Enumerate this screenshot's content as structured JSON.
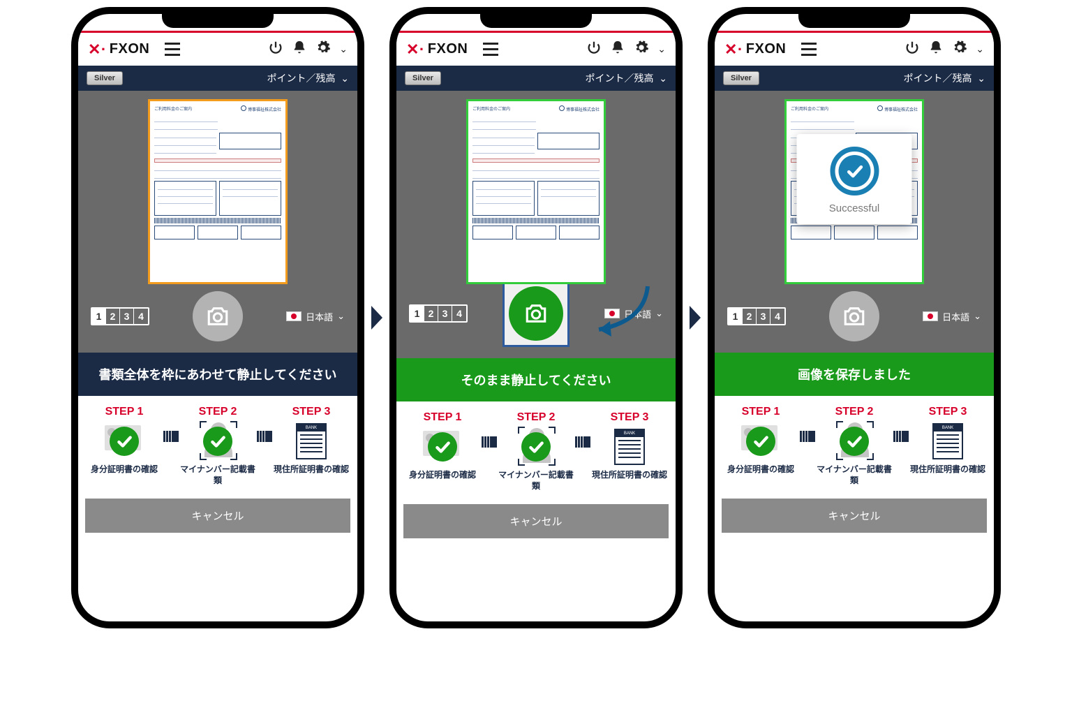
{
  "logo_text": "FXON",
  "tier_label": "Silver",
  "balance_label": "ポイント／残高",
  "language_label": "日本語",
  "language_dropdown_arrow": "⌄",
  "counter_values": [
    "1",
    "2",
    "3",
    "4"
  ],
  "step1_title": "STEP 1",
  "step2_title": "STEP 2",
  "step3_title": "STEP 3",
  "step1_desc": "身分証明書の確認",
  "step2_desc": "マイナンバー記載書類",
  "step3_desc": "現住所証明書の確認",
  "bank_label": "BANK",
  "cancel_label": "キャンセル",
  "success_text": "Successful",
  "doc_company": "博事福祉株式会社",
  "doc_heading": "ご利用料金のご案内",
  "screens": [
    {
      "banner": "書類全体を枠にあわせて静止してください",
      "banner_class": "banner-navy",
      "frame_class": "doc-orange",
      "shutter": "idle",
      "success": false
    },
    {
      "banner": "そのまま静止してください",
      "banner_class": "banner-green",
      "frame_class": "doc-green",
      "shutter": "active",
      "success": false
    },
    {
      "banner": "画像を保存しました",
      "banner_class": "banner-green",
      "frame_class": "doc-green",
      "shutter": "idle",
      "success": true
    }
  ]
}
